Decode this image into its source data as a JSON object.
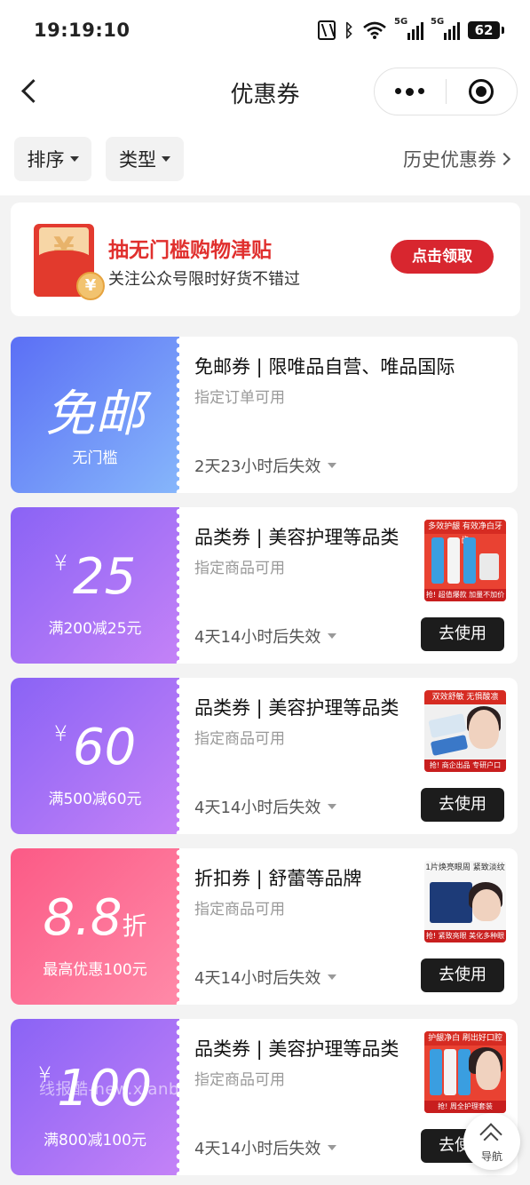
{
  "status_bar": {
    "time": "19:19:10",
    "net1": "5G",
    "net2": "5G",
    "battery": "62"
  },
  "nav": {
    "title": "优惠券"
  },
  "filters": {
    "sort_label": "排序",
    "type_label": "类型",
    "history_label": "历史优惠券"
  },
  "banner": {
    "title": "抽无门槛购物津贴",
    "subtitle": "关注公众号限时好货不错过",
    "button_label": "点击领取",
    "envelope_symbol": "¥"
  },
  "coupons": [
    {
      "amount": "免邮",
      "condition": "无门槛",
      "title": "免邮券 | 限唯品自营、唯品国际",
      "subtitle": "指定订单可用",
      "expiry": "2天23小时后失效"
    },
    {
      "currency": "¥",
      "amount": "25",
      "condition": "满200减25元",
      "title": "品类券 | 美容护理等品类",
      "subtitle": "指定商品可用",
      "expiry": "4天14小时后失效",
      "button_label": "去使用",
      "thumb_top": "多效护龈 有效净白牙齿",
      "thumb_bottom": "抢! 超值爆款 加量不加价"
    },
    {
      "currency": "¥",
      "amount": "60",
      "condition": "满500减60元",
      "title": "品类券 | 美容护理等品类",
      "subtitle": "指定商品可用",
      "expiry": "4天14小时后失效",
      "button_label": "去使用",
      "thumb_top": "双效舒敏 无惧酸凛",
      "thumb_bottom": "抢! 商企出品 专研户口"
    },
    {
      "amount": "8.8",
      "unit": "折",
      "condition": "最高优惠100元",
      "title": "折扣券 | 舒蕾等品牌",
      "subtitle": "指定商品可用",
      "expiry": "4天14小时后失效",
      "button_label": "去使用",
      "thumb_top": "1片焕亮眼周 紧致淡纹",
      "thumb_bottom": "抢! 紧致亮眼 美化多种眼周问题"
    },
    {
      "currency": "¥",
      "amount": "100",
      "condition": "满800减100元",
      "title": "品类券 | 美容护理等品类",
      "subtitle": "指定商品可用",
      "expiry": "4天14小时后失效",
      "button_label": "去使用",
      "thumb_top": "护龈净白 刷出好口腔",
      "thumb_bottom": "抢! 周全护理套装"
    }
  ],
  "float_nav": {
    "label": "导航"
  },
  "watermark": "线报酷-new.xianbao.fun",
  "colors": {
    "free_gradient": [
      "#5b6ff5",
      "#86b6fb"
    ],
    "purple_gradient": [
      "#8a63f5",
      "#c482f7"
    ],
    "pink_gradient": [
      "#fb5a86",
      "#ff8aa8"
    ],
    "use_button": "#1c1c1c",
    "banner_button": "#d8262f"
  }
}
